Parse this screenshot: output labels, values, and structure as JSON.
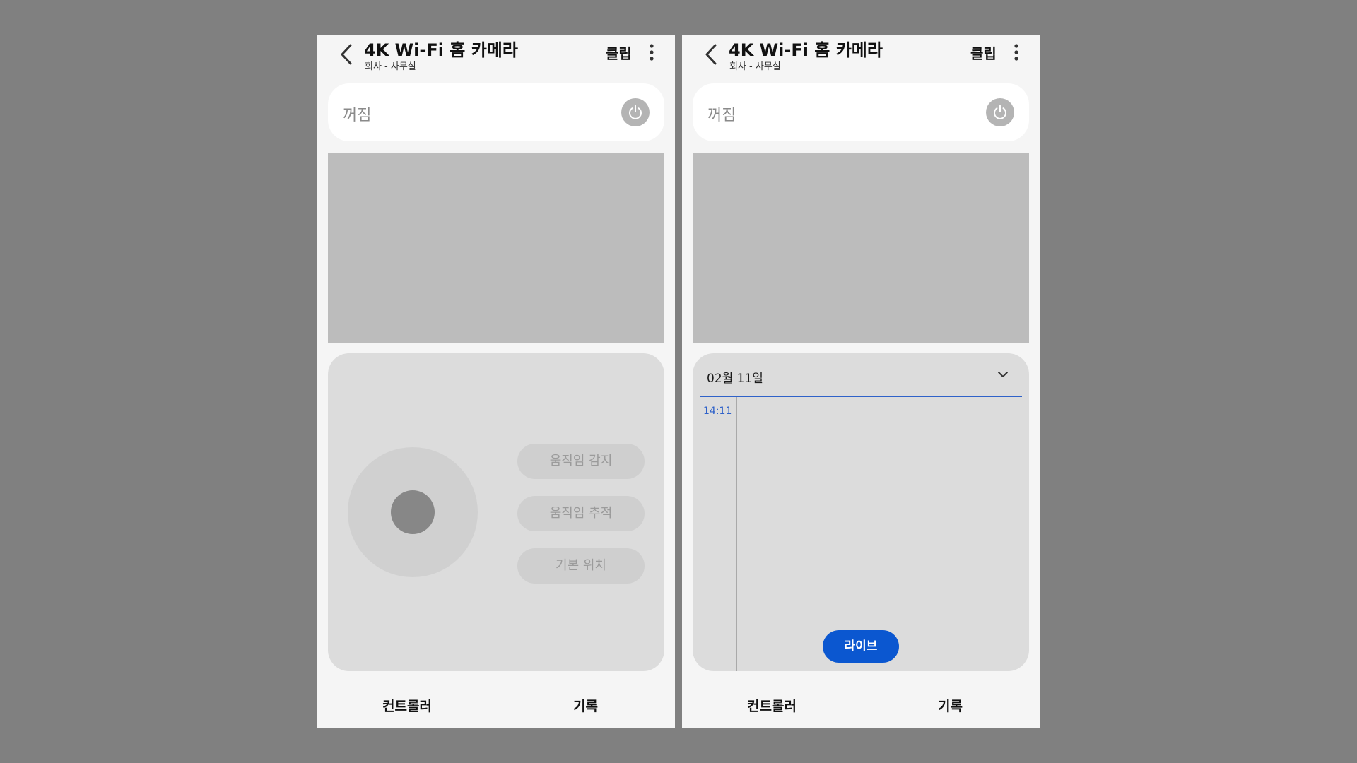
{
  "screens": [
    {
      "header": {
        "title": "4K Wi-Fi 홈 카메라",
        "subtitle": "회사 - 사무실",
        "clip_label": "클립"
      },
      "power": {
        "status": "꺼짐"
      },
      "controls": {
        "buttons": [
          "움직임 감지",
          "움직임 추적",
          "기본 위치"
        ]
      },
      "tabs": {
        "controller": "컨트롤러",
        "history": "기록"
      }
    },
    {
      "header": {
        "title": "4K Wi-Fi 홈 카메라",
        "subtitle": "회사 - 사무실",
        "clip_label": "클립"
      },
      "power": {
        "status": "꺼짐"
      },
      "history": {
        "date": "02월 11일",
        "time": "14:11",
        "live_label": "라이브"
      },
      "tabs": {
        "controller": "컨트롤러",
        "history": "기록"
      }
    }
  ],
  "icons": {
    "back": "chevron-left-icon",
    "more": "more-vertical-icon",
    "power": "power-icon",
    "dropdown": "chevron-down-icon"
  },
  "colors": {
    "background": "#808080",
    "screen": "#f5f5f5",
    "accent": "#0b57d0",
    "timeline_accent": "#2f62c9",
    "video_placeholder": "#bcbcbc",
    "panel": "#dcdcdc"
  }
}
